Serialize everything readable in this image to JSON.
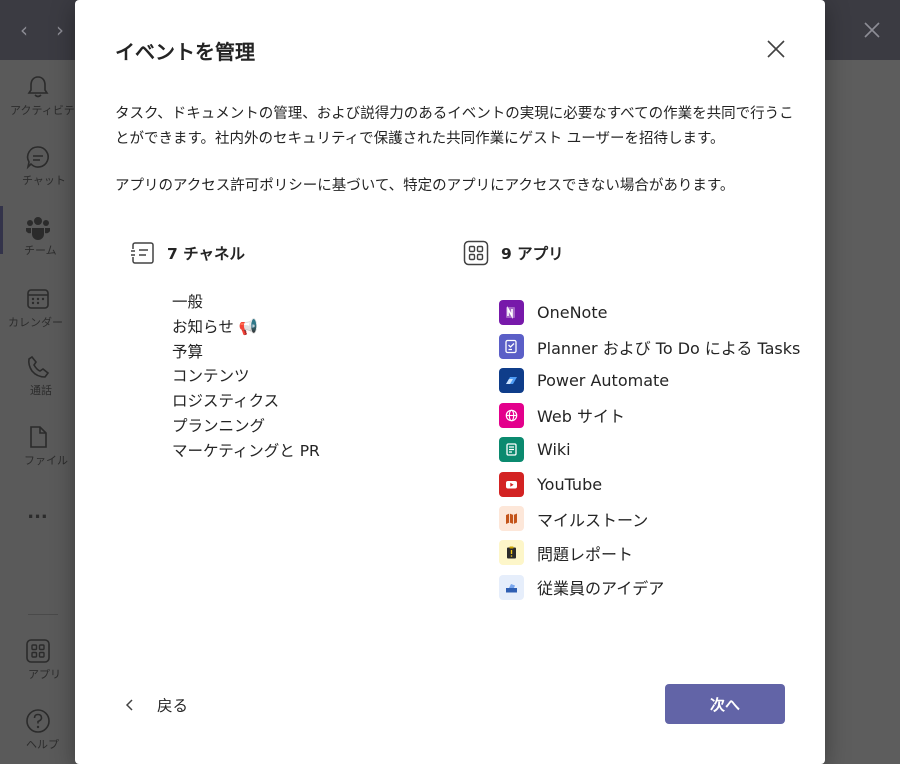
{
  "rail": {
    "items": [
      {
        "icon": "bell-icon",
        "label": "アクティビティ"
      },
      {
        "icon": "chat-icon",
        "label": "チャット"
      },
      {
        "icon": "teams-icon",
        "label": "チーム"
      },
      {
        "icon": "calendar-icon",
        "label": "カレンダー"
      },
      {
        "icon": "phone-icon",
        "label": "通話"
      },
      {
        "icon": "file-icon",
        "label": "ファイル"
      },
      {
        "icon": "more-icon",
        "label": "..."
      },
      {
        "icon": "apps-icon",
        "label": "アプリ"
      },
      {
        "icon": "help-icon",
        "label": "ヘルプ"
      }
    ]
  },
  "dialog": {
    "title": "イベントを管理",
    "description_1": "タスク、ドキュメントの管理、および説得力のあるイベントの実現に必要なすべての作業を共同で行うことができます。社内外のセキュリティで保護された共同作業にゲスト ユーザーを招待します。",
    "description_2": "アプリのアクセス許可ポリシーに基づいて、特定のアプリにアクセスできない場合があります。",
    "channels_heading": "7 チャネル",
    "apps_heading": "9 アプリ",
    "channels": [
      "一般",
      "お知らせ 📢",
      "予算",
      "コンテンツ",
      "ロジスティクス",
      "プランニング",
      "マーケティングと PR"
    ],
    "apps": [
      {
        "name": "OneNote",
        "icon": "onenote-icon",
        "color": "#7719aa"
      },
      {
        "name": "Planner および To Do による Tasks",
        "icon": "tasks-icon",
        "color": "#5b5fc7"
      },
      {
        "name": "Power Automate",
        "icon": "power-automate-icon",
        "color": "#0f3d8a"
      },
      {
        "name": "Web サイト",
        "icon": "globe-icon",
        "color": "#e3008c"
      },
      {
        "name": "Wiki",
        "icon": "wiki-icon",
        "color": "#0b8a6f"
      },
      {
        "name": "YouTube",
        "icon": "youtube-icon",
        "color": "#d32323"
      },
      {
        "name": "マイルストーン",
        "icon": "map-icon",
        "color": "#fde7d9"
      },
      {
        "name": "問題レポート",
        "icon": "clipboard-alert-icon",
        "color": "#fdf6c9"
      },
      {
        "name": "従業員のアイデア",
        "icon": "idea-box-icon",
        "color": "#e6eefb"
      }
    ],
    "back_label": "戻る",
    "next_label": "次へ"
  }
}
